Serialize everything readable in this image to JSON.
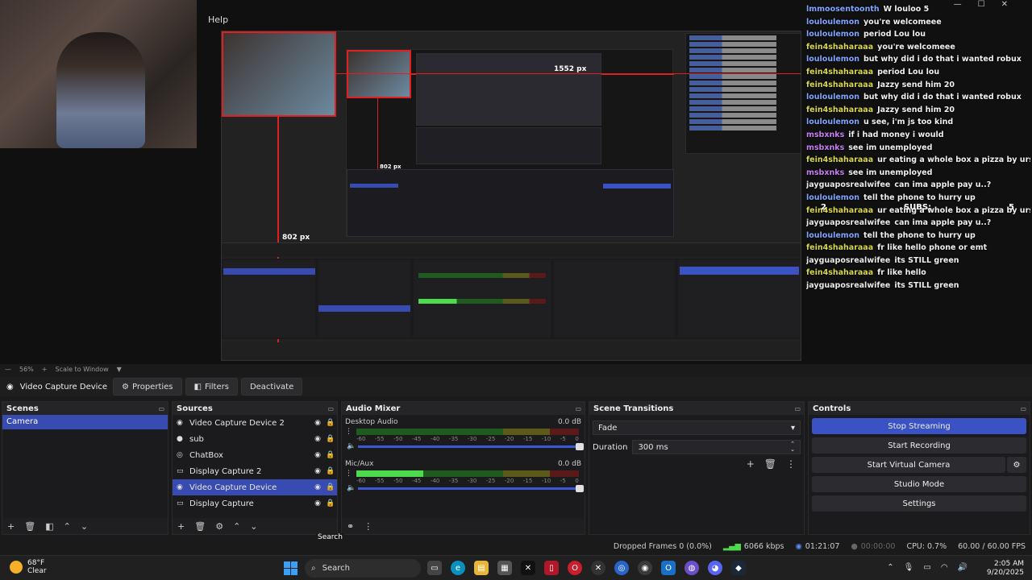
{
  "top": {
    "help_label": "Help",
    "window_controls": [
      "—",
      "☐",
      "✕"
    ],
    "px_label_a": "1552 px",
    "px_label_b": "802 px",
    "px_label_c": "802 px",
    "zoom_percent": "56%",
    "scale_mode": "Scale to Window"
  },
  "chat": {
    "lines": [
      {
        "user": "lmmoosentoonth",
        "msg": "W louloo 5",
        "kind": "b"
      },
      {
        "user": "louloulemon",
        "msg": "you're welcomeee",
        "kind": "b"
      },
      {
        "user": "louloulemon",
        "msg": "period Lou lou",
        "kind": "b"
      },
      {
        "user": "fein4shaharaaa",
        "msg": "you're welcomeee",
        "kind": "g"
      },
      {
        "user": "louloulemon",
        "msg": "but why did i do that i wanted robux",
        "kind": "b"
      },
      {
        "user": "fein4shaharaaa",
        "msg": "period Lou lou",
        "kind": "g"
      },
      {
        "user": "fein4shaharaaa",
        "msg": "Jazzy send him 20",
        "kind": "g"
      },
      {
        "user": "louloulemon",
        "msg": "but why did i do that i wanted robux",
        "kind": "b"
      },
      {
        "user": "fein4shaharaaa",
        "msg": "Jazzy send him 20",
        "kind": "g"
      },
      {
        "user": "louloulemon",
        "msg": "u see, i'm js too kind",
        "kind": "b"
      },
      {
        "user": "msbxnks",
        "msg": "if i had money i would",
        "kind": "p"
      },
      {
        "user": "msbxnks",
        "msg": "see im unemployed",
        "kind": "p"
      },
      {
        "user": "fein4shaharaaa",
        "msg": "ur eating a whole box a pizza by urself ?",
        "kind": "g"
      },
      {
        "user": "msbxnks",
        "msg": "see im unemployed",
        "kind": "p"
      },
      {
        "user": "jayguaposrealwifee",
        "msg": "can ima apple pay u..?",
        "kind": "w"
      },
      {
        "user": "louloulemon",
        "msg": "tell the phone to hurry up",
        "kind": "b"
      },
      {
        "user": "fein4shaharaaa",
        "msg": "ur eating a whole box a pizza by urself ?",
        "kind": "g"
      },
      {
        "user": "jayguaposrealwifee",
        "msg": "can ima apple pay u..?",
        "kind": "w"
      },
      {
        "user": "louloulemon",
        "msg": "tell the phone to hurry up",
        "kind": "b"
      },
      {
        "user": "fein4shaharaaa",
        "msg": "fr like hello phone or emt",
        "kind": "g"
      },
      {
        "user": "jayguaposrealwifee",
        "msg": "its STILL green",
        "kind": "w"
      },
      {
        "user": "fein4shaharaaa",
        "msg": "fr like hello",
        "kind": "g"
      },
      {
        "user": "jayguaposrealwifee",
        "msg": "its STILL green",
        "kind": "w"
      }
    ],
    "subs_left": "2",
    "subs_label": "SUBS:",
    "subs_right": "5"
  },
  "source_toolbar": {
    "source_name": "Video Capture Device",
    "properties": "Properties",
    "filters": "Filters",
    "deactivate": "Deactivate"
  },
  "scenes": {
    "title": "Scenes",
    "items": [
      "Camera"
    ]
  },
  "sources": {
    "title": "Sources",
    "items": [
      {
        "icon": "◉",
        "label": "Video Capture Device 2"
      },
      {
        "icon": "●",
        "label": "sub"
      },
      {
        "icon": "◎",
        "label": "ChatBox"
      },
      {
        "icon": "▭",
        "label": "Display Capture 2"
      },
      {
        "icon": "◉",
        "label": "Video Capture Device"
      },
      {
        "icon": "▭",
        "label": "Display Capture"
      }
    ]
  },
  "mixer": {
    "title": "Audio Mixer",
    "channels": [
      {
        "name": "Desktop Audio",
        "db": "0.0 dB",
        "level": 0
      },
      {
        "name": "Mic/Aux",
        "db": "0.0 dB",
        "level": 0.3
      }
    ],
    "ticks": [
      "-60",
      "-55",
      "-50",
      "-45",
      "-40",
      "-35",
      "-30",
      "-25",
      "-20",
      "-15",
      "-10",
      "-5",
      "0"
    ]
  },
  "transitions": {
    "title": "Scene Transitions",
    "selected": "Fade",
    "duration_label": "Duration",
    "duration_value": "300 ms"
  },
  "controls": {
    "title": "Controls",
    "stop_streaming": "Stop Streaming",
    "start_recording": "Start Recording",
    "start_virtual_camera": "Start Virtual Camera",
    "studio_mode": "Studio Mode",
    "settings": "Settings"
  },
  "status": {
    "dropped_frames": "Dropped Frames 0 (0.0%)",
    "bitrate": "6066 kbps",
    "stream_time": "01:21:07",
    "rec_time": "00:00:00",
    "cpu": "CPU: 0.7%",
    "fps": "60.00 / 60.00 FPS"
  },
  "search_tooltip": "Search",
  "taskbar": {
    "temp": "68°F",
    "weather": "Clear",
    "search_placeholder": "Search",
    "time": "2:05 AM",
    "date": "9/20/2025"
  },
  "colors": {
    "accent": "#384bb0",
    "stop_streaming": "#3b52c4",
    "selection_box": "#e02020"
  }
}
